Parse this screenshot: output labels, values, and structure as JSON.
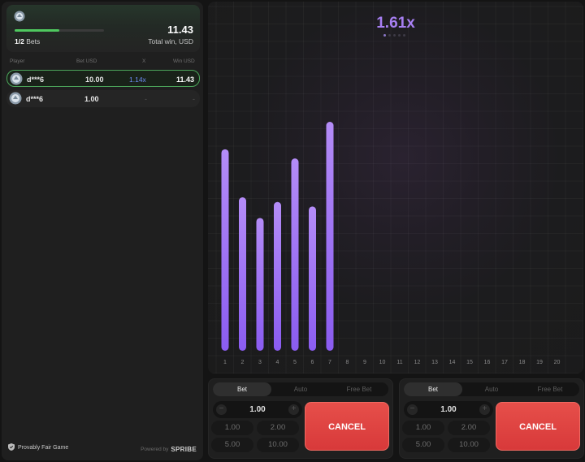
{
  "summary": {
    "bets_count": "1/2",
    "bets_label": "Bets",
    "total_win": "11.43",
    "total_win_label": "Total win, USD",
    "progress_fraction": 0.5
  },
  "table": {
    "headers": {
      "player": "Player",
      "bet": "Bet USD",
      "x": "X",
      "win": "Win USD"
    },
    "rows": [
      {
        "player": "d***6",
        "bet": "10.00",
        "multiplier": "1.14x",
        "win": "11.43"
      },
      {
        "player": "d***6",
        "bet": "1.00",
        "multiplier": "-",
        "win": "-"
      }
    ]
  },
  "footer": {
    "provably_fair": "Provably Fair Game",
    "powered_by": "Powered by",
    "brand": "SPRIBE"
  },
  "game": {
    "current_multiplier": "1.61x",
    "dots": 5,
    "active_dot": 1
  },
  "chart_data": {
    "type": "bar",
    "categories": [
      "1",
      "2",
      "3",
      "4",
      "5",
      "6",
      "7",
      "8",
      "9",
      "10",
      "11",
      "12",
      "13",
      "14",
      "15",
      "16",
      "17",
      "18",
      "19",
      "20"
    ],
    "values": [
      0.88,
      0.67,
      0.58,
      0.65,
      0.84,
      0.63,
      1.0,
      null,
      null,
      null,
      null,
      null,
      null,
      null,
      null,
      null,
      null,
      null,
      null,
      null
    ],
    "ylim": [
      0,
      1
    ],
    "bar_color": "#9d6ff2"
  },
  "bet_panels": [
    {
      "tabs": [
        "Bet",
        "Auto",
        "Free Bet"
      ],
      "active_tab": "Bet",
      "amount": "1.00",
      "minus": "−",
      "plus": "+",
      "quick": [
        "1.00",
        "2.00",
        "5.00",
        "10.00"
      ],
      "action": "CANCEL"
    },
    {
      "tabs": [
        "Bet",
        "Auto",
        "Free Bet"
      ],
      "active_tab": "Bet",
      "amount": "1.00",
      "minus": "−",
      "plus": "+",
      "quick": [
        "1.00",
        "2.00",
        "5.00",
        "10.00"
      ],
      "action": "CANCEL"
    }
  ],
  "colors": {
    "accent_purple": "#a77ff2",
    "win_green": "#4fc95f",
    "cancel_red": "#e64f4a",
    "multiplier_blue": "#6d8cf5"
  }
}
